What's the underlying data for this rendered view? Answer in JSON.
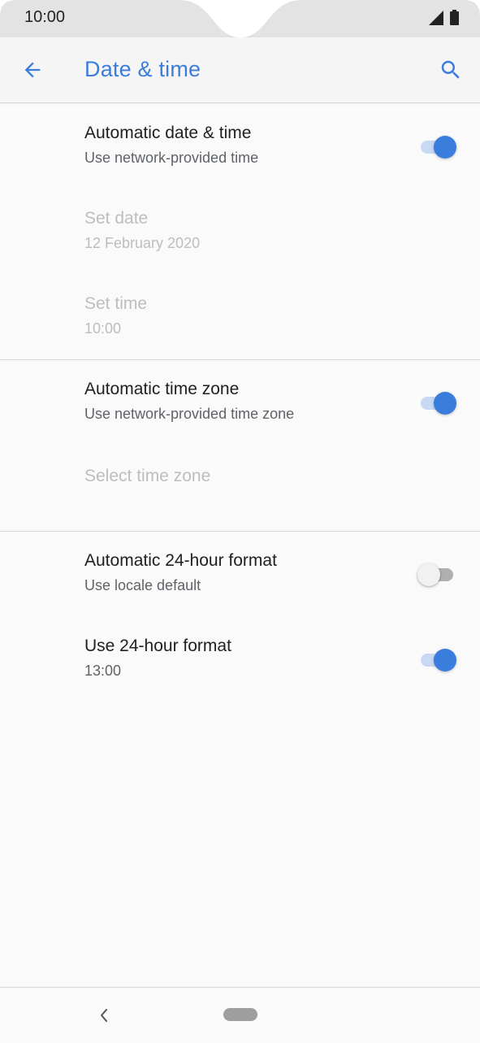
{
  "status_bar": {
    "time": "10:00"
  },
  "app_bar": {
    "title": "Date & time",
    "back_icon": "arrow-back-icon",
    "search_icon": "search-icon",
    "accent_color": "#3b7ddd"
  },
  "settings": [
    {
      "title": "Automatic date & time",
      "summary": "Use network-provided time",
      "toggle": true,
      "enabled": true
    },
    {
      "title": "Set date",
      "summary": "12 February 2020",
      "enabled": false
    },
    {
      "title": "Set time",
      "summary": "10:00",
      "enabled": false
    },
    {
      "title": "Automatic time zone",
      "summary": "Use network-provided time zone",
      "toggle": true,
      "enabled": true
    },
    {
      "title": "Select time zone",
      "enabled": false
    },
    {
      "title": "Automatic 24-hour format",
      "summary": "Use locale default",
      "toggle": false,
      "enabled": true
    },
    {
      "title": "Use 24-hour format",
      "summary": "13:00",
      "toggle": true,
      "enabled": true
    }
  ],
  "nav_bar": {
    "back_icon": "nav-back-icon",
    "home_icon": "home-pill-icon"
  }
}
